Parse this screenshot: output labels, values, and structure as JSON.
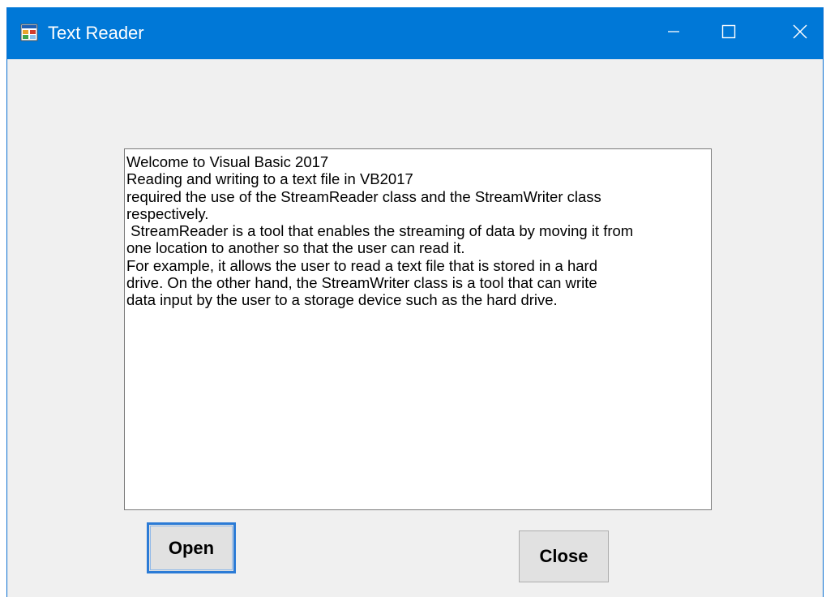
{
  "window": {
    "title": "Text Reader"
  },
  "titlebar_buttons": {
    "minimize_icon": "minimize-icon",
    "maximize_icon": "maximize-icon",
    "close_icon": "close-icon"
  },
  "textbox": {
    "lines": [
      "Welcome to Visual Basic 2017",
      "Reading and writing to a text file in VB2017",
      "required the use of the StreamReader class and the StreamWriter class",
      "respectively.",
      " StreamReader is a tool that enables the streaming of data by moving it from",
      "one location to another so that the user can read it.",
      "For example, it allows the user to read a text file that is stored in a hard",
      "drive. On the other hand, the StreamWriter class is a tool that can write",
      "data input by the user to a storage device such as the hard drive."
    ]
  },
  "buttons": {
    "open_label": "Open",
    "close_label": "Close"
  },
  "colors": {
    "titlebar": "#0078d7",
    "window_bg": "#f0f0f0",
    "button_bg": "#e1e1e1",
    "focus_border": "#2b7bd6"
  }
}
